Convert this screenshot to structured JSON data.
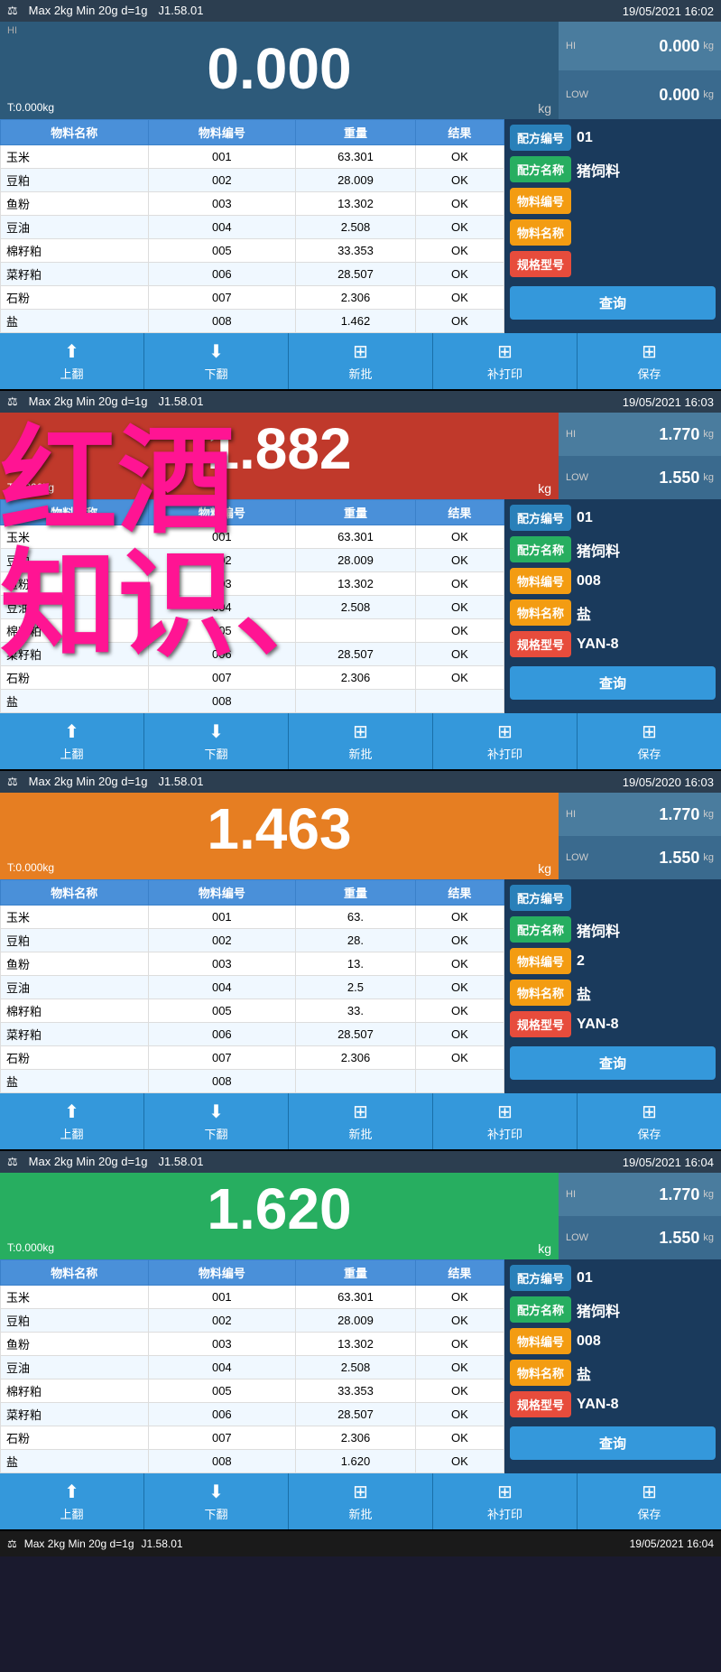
{
  "app": {
    "spec": "Max 2kg  Min 20g  d=1g",
    "version": "J1.58.01"
  },
  "panels": [
    {
      "id": "panel1",
      "datetime": "19/05/2021  16:02",
      "weight_display": "0.000",
      "weight_bg": "normal",
      "tare": "T:0.000kg",
      "unit": "kg",
      "hi_value": "0.000",
      "low_value": "0.000",
      "table_headers": [
        "物料名称",
        "物料编号",
        "重量",
        "结果"
      ],
      "table_rows": [
        [
          "玉米",
          "001",
          "63.301",
          "OK"
        ],
        [
          "豆粕",
          "002",
          "28.009",
          "OK"
        ],
        [
          "鱼粉",
          "003",
          "13.302",
          "OK"
        ],
        [
          "豆油",
          "004",
          "2.508",
          "OK"
        ],
        [
          "棉籽粕",
          "005",
          "33.353",
          "OK"
        ],
        [
          "菜籽粕",
          "006",
          "28.507",
          "OK"
        ],
        [
          "石粉",
          "007",
          "2.306",
          "OK"
        ],
        [
          "盐",
          "008",
          "1.462",
          "OK"
        ]
      ],
      "side": {
        "formula_no_label": "配方编号",
        "formula_no_value": "01",
        "formula_name_label": "配方名称",
        "formula_name_value": "猪饲料",
        "material_no_label": "物料编号",
        "material_no_value": "",
        "material_name_label": "物料名称",
        "material_name_value": "",
        "spec_label": "规格型号",
        "spec_value": "",
        "query_label": "查询"
      },
      "toolbar": [
        "上翻",
        "下翻",
        "新批",
        "补打印",
        "保存"
      ]
    },
    {
      "id": "panel2",
      "datetime": "19/05/2021  16:03",
      "weight_display": "1.882",
      "weight_bg": "red",
      "tare": "T:0.000kg",
      "unit": "kg",
      "hi_value": "1.770",
      "low_value": "1.550",
      "table_headers": [
        "物料名称",
        "物料编号",
        "重量",
        "结果"
      ],
      "table_rows": [
        [
          "玉米",
          "001",
          "63.301",
          "OK"
        ],
        [
          "豆粕",
          "002",
          "28.009",
          "OK"
        ],
        [
          "鱼粉",
          "003",
          "13.302",
          "OK"
        ],
        [
          "豆油",
          "004",
          "2.508",
          "OK"
        ],
        [
          "棉籽粕",
          "005",
          "",
          "OK"
        ],
        [
          "菜籽粕",
          "006",
          "28.507",
          "OK"
        ],
        [
          "石粉",
          "007",
          "2.306",
          "OK"
        ],
        [
          "盐",
          "008",
          "",
          ""
        ]
      ],
      "side": {
        "formula_no_label": "配方编号",
        "formula_no_value": "01",
        "formula_name_label": "配方名称",
        "formula_name_value": "猪饲料",
        "material_no_label": "物料编号",
        "material_no_value": "008",
        "material_name_label": "物料名称",
        "material_name_value": "盐",
        "spec_label": "规格型号",
        "spec_value": "YAN-8",
        "query_label": "查询"
      },
      "toolbar": [
        "上翻",
        "下翻",
        "新批",
        "补打印",
        "保存"
      ]
    },
    {
      "id": "panel3",
      "datetime": "19/05/2020  16:03",
      "weight_display": "1.463",
      "weight_bg": "orange",
      "tare": "T:0.000kg",
      "unit": "kg",
      "hi_value": "1.770",
      "low_value": "1.550",
      "table_headers": [
        "物料名称",
        "物料编号",
        "重量",
        "结果"
      ],
      "table_rows": [
        [
          "玉米",
          "001",
          "63.",
          "OK"
        ],
        [
          "豆粕",
          "002",
          "28.",
          "OK"
        ],
        [
          "鱼粉",
          "003",
          "13.",
          "OK"
        ],
        [
          "豆油",
          "004",
          "2.5",
          "OK"
        ],
        [
          "棉籽粕",
          "005",
          "33.",
          "OK"
        ],
        [
          "菜籽粕",
          "006",
          "28.507",
          "OK"
        ],
        [
          "石粉",
          "007",
          "2.306",
          "OK"
        ],
        [
          "盐",
          "008",
          "",
          ""
        ]
      ],
      "side": {
        "formula_no_label": "配方编号",
        "formula_no_value": "",
        "formula_name_label": "配方名称",
        "formula_name_value": "猪饲料",
        "material_no_label": "物料编号",
        "material_no_value": "2",
        "material_name_label": "物料名称",
        "material_name_value": "盐",
        "spec_label": "规格型号",
        "spec_value": "YAN-8",
        "query_label": "查询"
      },
      "toolbar": [
        "上翻",
        "下翻",
        "新批",
        "补打印",
        "保存"
      ]
    },
    {
      "id": "panel4",
      "datetime": "19/05/2021  16:04",
      "weight_display": "1.620",
      "weight_bg": "green",
      "tare": "T:0.000kg",
      "unit": "kg",
      "hi_value": "1.770",
      "low_value": "1.550",
      "table_headers": [
        "物料名称",
        "物料编号",
        "重量",
        "结果"
      ],
      "table_rows": [
        [
          "玉米",
          "001",
          "63.301",
          "OK"
        ],
        [
          "豆粕",
          "002",
          "28.009",
          "OK"
        ],
        [
          "鱼粉",
          "003",
          "13.302",
          "OK"
        ],
        [
          "豆油",
          "004",
          "2.508",
          "OK"
        ],
        [
          "棉籽粕",
          "005",
          "33.353",
          "OK"
        ],
        [
          "菜籽粕",
          "006",
          "28.507",
          "OK"
        ],
        [
          "石粉",
          "007",
          "2.306",
          "OK"
        ],
        [
          "盐",
          "008",
          "1.620",
          "OK"
        ]
      ],
      "side": {
        "formula_no_label": "配方编号",
        "formula_no_value": "01",
        "formula_name_label": "配方名称",
        "formula_name_value": "猪饲料",
        "material_no_label": "物料编号",
        "material_no_value": "008",
        "material_name_label": "物料名称",
        "material_name_value": "盐",
        "spec_label": "规格型号",
        "spec_value": "YAN-8",
        "query_label": "查询"
      },
      "toolbar": [
        "上翻",
        "下翻",
        "新批",
        "补打印",
        "保存"
      ]
    }
  ],
  "bottom_nav": {
    "spec": "Max 2kg  Min 20g  d=1g",
    "version": "J1.58.01",
    "datetime": "19/05/2021  16:04"
  },
  "watermark": {
    "line1": "红酒",
    "line2": "知识、"
  },
  "toolbar_icons": {
    "up": "▲",
    "down": "▼",
    "new": "⊞",
    "print": "⊞",
    "save": "⊞"
  }
}
